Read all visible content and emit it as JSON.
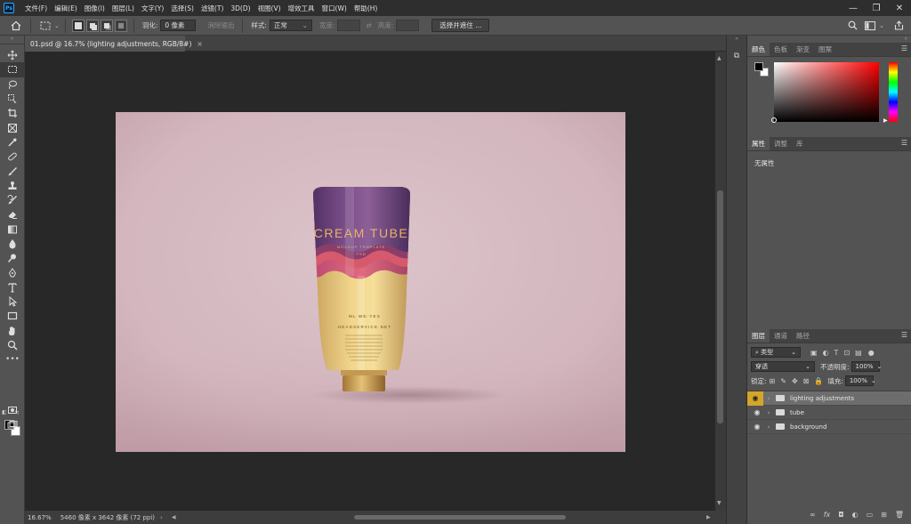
{
  "app": {
    "logo": "Ps"
  },
  "menu": [
    "文件(F)",
    "编辑(E)",
    "图像(I)",
    "图层(L)",
    "文字(Y)",
    "选择(S)",
    "滤镜(T)",
    "3D(D)",
    "视图(V)",
    "增效工具",
    "窗口(W)",
    "帮助(H)"
  ],
  "window_controls": {
    "minimize": "—",
    "maximize": "❐",
    "close": "✕"
  },
  "options": {
    "feather_label": "羽化:",
    "feather_value": "0 像素",
    "antialias_label": "消除锯齿",
    "style_label": "样式:",
    "style_value": "正常",
    "width_label": "宽度:",
    "height_label": "高度:",
    "select_mask_button": "选择并遮住 ..."
  },
  "document": {
    "tab_title": "01.psd @ 16.7% (lighting adjustments, RGB/8#)",
    "close": "×",
    "zoom": "16.67%",
    "size_info": "5460 像素 x 3642 像素 (72 ppi)",
    "canvas_bg": "#d9bfc6"
  },
  "product": {
    "title": "CREAM TUBE",
    "subtitle": "MOCKUP TEMPLATE",
    "tag": "PSD",
    "body_line1": "ML WE-YES",
    "body_line2": "HEADSERVICE.NET"
  },
  "panels": {
    "color_tabs": [
      "颜色",
      "色板",
      "渐变",
      "图案"
    ],
    "properties_tabs": [
      "属性",
      "调整",
      "库"
    ],
    "properties_empty": "无属性",
    "layers_tabs": [
      "图层",
      "通道",
      "路径"
    ]
  },
  "layers": {
    "filter_label": "类型",
    "blend_mode": "穿透",
    "opacity_label": "不透明度:",
    "opacity_value": "100%",
    "lock_label": "锁定:",
    "fill_label": "填充:",
    "fill_value": "100%",
    "items": [
      {
        "name": "lighting adjustments",
        "selected": true
      },
      {
        "name": "tube",
        "selected": false
      },
      {
        "name": "background",
        "selected": false
      }
    ]
  },
  "colors": {
    "accent": "#31a8ff",
    "selected_layer_eye": "#d3a62a",
    "workspace": "#282828",
    "panel": "#535353"
  }
}
